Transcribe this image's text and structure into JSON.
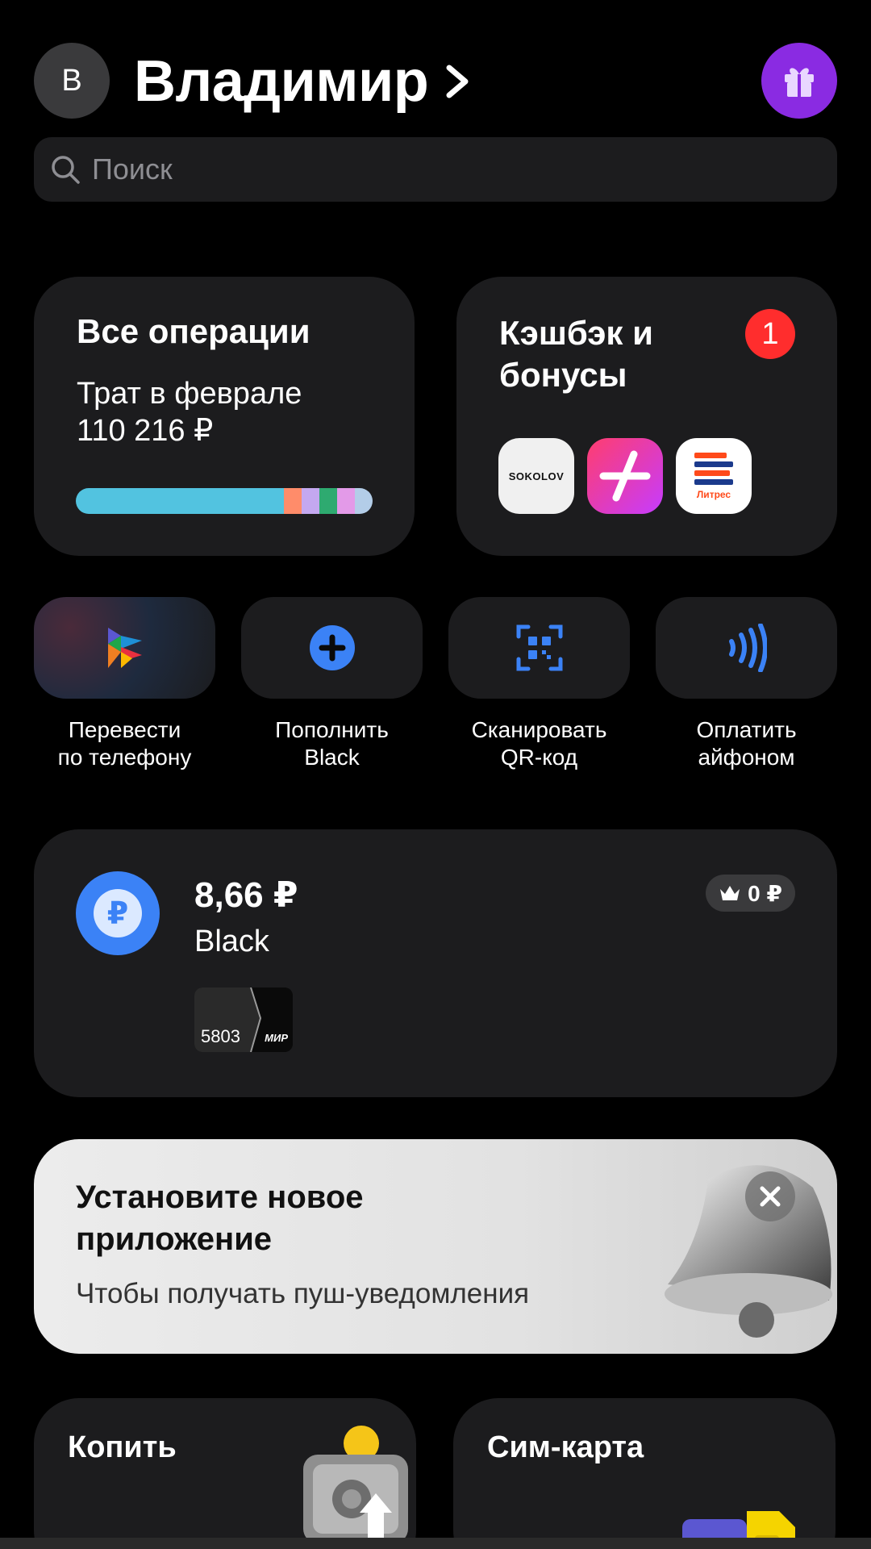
{
  "header": {
    "avatar_letter": "В",
    "user_name": "Владимир"
  },
  "search": {
    "placeholder": "Поиск"
  },
  "operations_card": {
    "title": "Все операции",
    "spend_label": "Трат в феврале",
    "spend_amount": "110 216 ₽",
    "spend_breakdown_colors": [
      "#52c3e0",
      "#ff8c6a",
      "#c4a8f0",
      "#2eaa70",
      "#e39ae8",
      "#b3cde8"
    ]
  },
  "cashback_card": {
    "title": "Кэшбэк и бонусы",
    "badge_count": "1",
    "partners": [
      {
        "name": "SOKOLOV",
        "icon": "sokolov-logo"
      },
      {
        "name": "plus-logo",
        "icon": "plus-logo"
      },
      {
        "name": "Литрес",
        "icon": "litres-logo"
      }
    ]
  },
  "quick_actions": [
    {
      "label": "Перевести\nпо телефону",
      "icon": "sbp-transfer-icon"
    },
    {
      "label": "Пополнить\nBlack",
      "icon": "plus-circle-icon"
    },
    {
      "label": "Сканировать\nQR-код",
      "icon": "qr-scan-icon"
    },
    {
      "label": "Оплатить\nайфоном",
      "icon": "contactless-pay-icon"
    }
  ],
  "account": {
    "balance": "8,66 ₽",
    "name": "Black",
    "bonus_badge": "0 ₽",
    "card_number": "5803",
    "card_system": "МИР"
  },
  "promo": {
    "title": "Установите новое приложение",
    "subtitle": "Чтобы получать пуш-уведомления"
  },
  "tiles": [
    {
      "title": "Копить",
      "icon": "safe-icon"
    },
    {
      "title": "Сим-карта",
      "icon": "sim-card-icon"
    }
  ]
}
